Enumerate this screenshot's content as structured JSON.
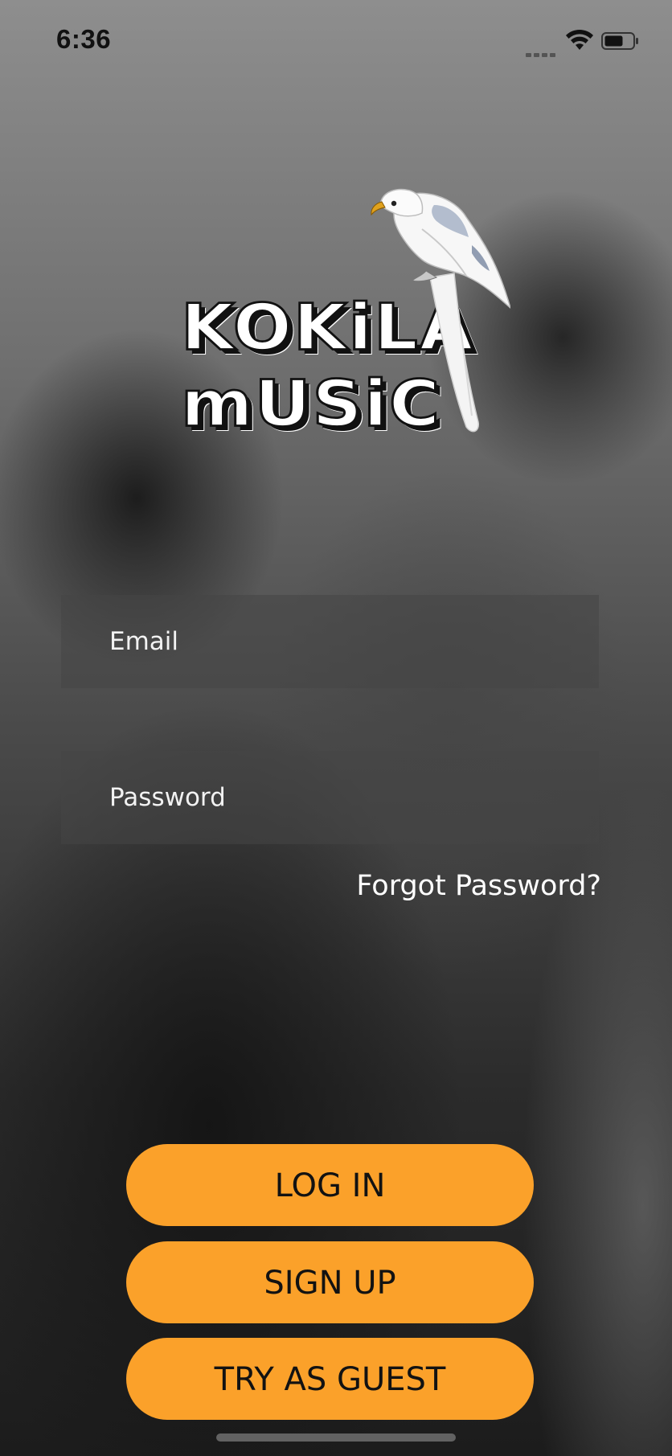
{
  "status_bar": {
    "time": "6:36"
  },
  "logo": {
    "line1": "KOKiLA",
    "line2": "mUSiC"
  },
  "form": {
    "email_placeholder": "Email",
    "password_placeholder": "Password",
    "forgot_password": "Forgot Password?"
  },
  "buttons": {
    "login": "LOG IN",
    "signup": "SIGN UP",
    "guest": "TRY AS GUEST"
  },
  "colors": {
    "accent": "#fba12a",
    "button_text": "#121212",
    "field_bg": "#464646"
  },
  "icons": [
    "signal-icon",
    "wifi-icon",
    "battery-icon",
    "bird-logo-icon"
  ]
}
